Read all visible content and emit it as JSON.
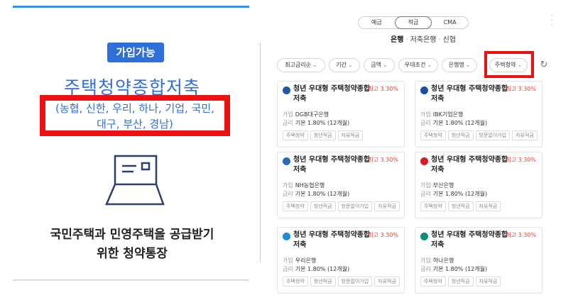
{
  "left": {
    "badge": "가입가능",
    "title": "주택청약종합저축",
    "banks_line1": "(농협, 신한, 우리, 하나, 기업, 국민,",
    "banks_line2": "대구, 부산, 경남)",
    "icon": "envelope-icon",
    "desc_line1": "국민주택과 민영주택을 공급받기",
    "desc_line2": "위한 청약통장"
  },
  "right": {
    "segments": [
      "예금",
      "적금",
      "CMA"
    ],
    "active_segment": "적금",
    "breadcrumb": {
      "bold": "은행",
      "rest1": "저축은행",
      "rest2": "신협"
    },
    "filters": [
      "최고금리순",
      "기간",
      "금액",
      "우대조건",
      "은행명",
      "주택청약"
    ],
    "cards": [
      {
        "name": "청년 우대형 주택청약종합저축",
        "rate": "최고 3.30%",
        "join_k": "가입",
        "bank": "DGB대구은행",
        "rate_k": "금리",
        "base": "기본 1.80% (12개월)",
        "tags": [
          "주택청약",
          "청년적금",
          "자유적금"
        ],
        "logo_color": "#1f5aa8"
      },
      {
        "name": "청년 우대형 주택청약종합저축",
        "rate": "최고 3.30%",
        "join_k": "가입",
        "bank": "IBK기업은행",
        "rate_k": "금리",
        "base": "기본 1.80% (12개월)",
        "tags": [
          "주택청약",
          "청년적금",
          "방문없이가입",
          "자유적금"
        ],
        "logo_color": "#1b4f9c"
      },
      {
        "name": "청년 우대형 주택청약종합저축",
        "rate": "최고 3.30%",
        "join_k": "가입",
        "bank": "NH농협은행",
        "rate_k": "금리",
        "base": "기본 1.80% (12개월)",
        "tags": [
          "주택청약",
          "청년적금",
          "방문없이가입",
          "자유적금"
        ],
        "logo_color": "#2a6bb5"
      },
      {
        "name": "청년 우대형 주택청약종합저축",
        "rate": "최고 3.30%",
        "join_k": "가입",
        "bank": "부산은행",
        "rate_k": "금리",
        "base": "기본 1.80% (12개월)",
        "tags": [
          "주택청약",
          "청년적금",
          "자유적금"
        ],
        "logo_color": "#d71920"
      },
      {
        "name": "청년 우대형 주택청약종합저축",
        "rate": "최고 3.30%",
        "join_k": "가입",
        "bank": "우리은행",
        "rate_k": "금리",
        "base": "기본 1.80% (12개월)",
        "tags": [
          "주택청약",
          "청년적금",
          "방문없이가입",
          "자유적금"
        ],
        "logo_color": "#1a8fd8"
      },
      {
        "name": "청년 우대형 주택청약종합저축",
        "rate": "최고 3.30%",
        "join_k": "가입",
        "bank": "하나은행",
        "rate_k": "금리",
        "base": "기본 1.80% (12개월)",
        "tags": [
          "주택청약",
          "청년적금",
          "자유적금"
        ],
        "logo_color": "#0f8c7a"
      }
    ]
  },
  "colors": {
    "accent": "#2f6fd8",
    "highlight": "#ee1111",
    "rate": "#e0443a"
  }
}
